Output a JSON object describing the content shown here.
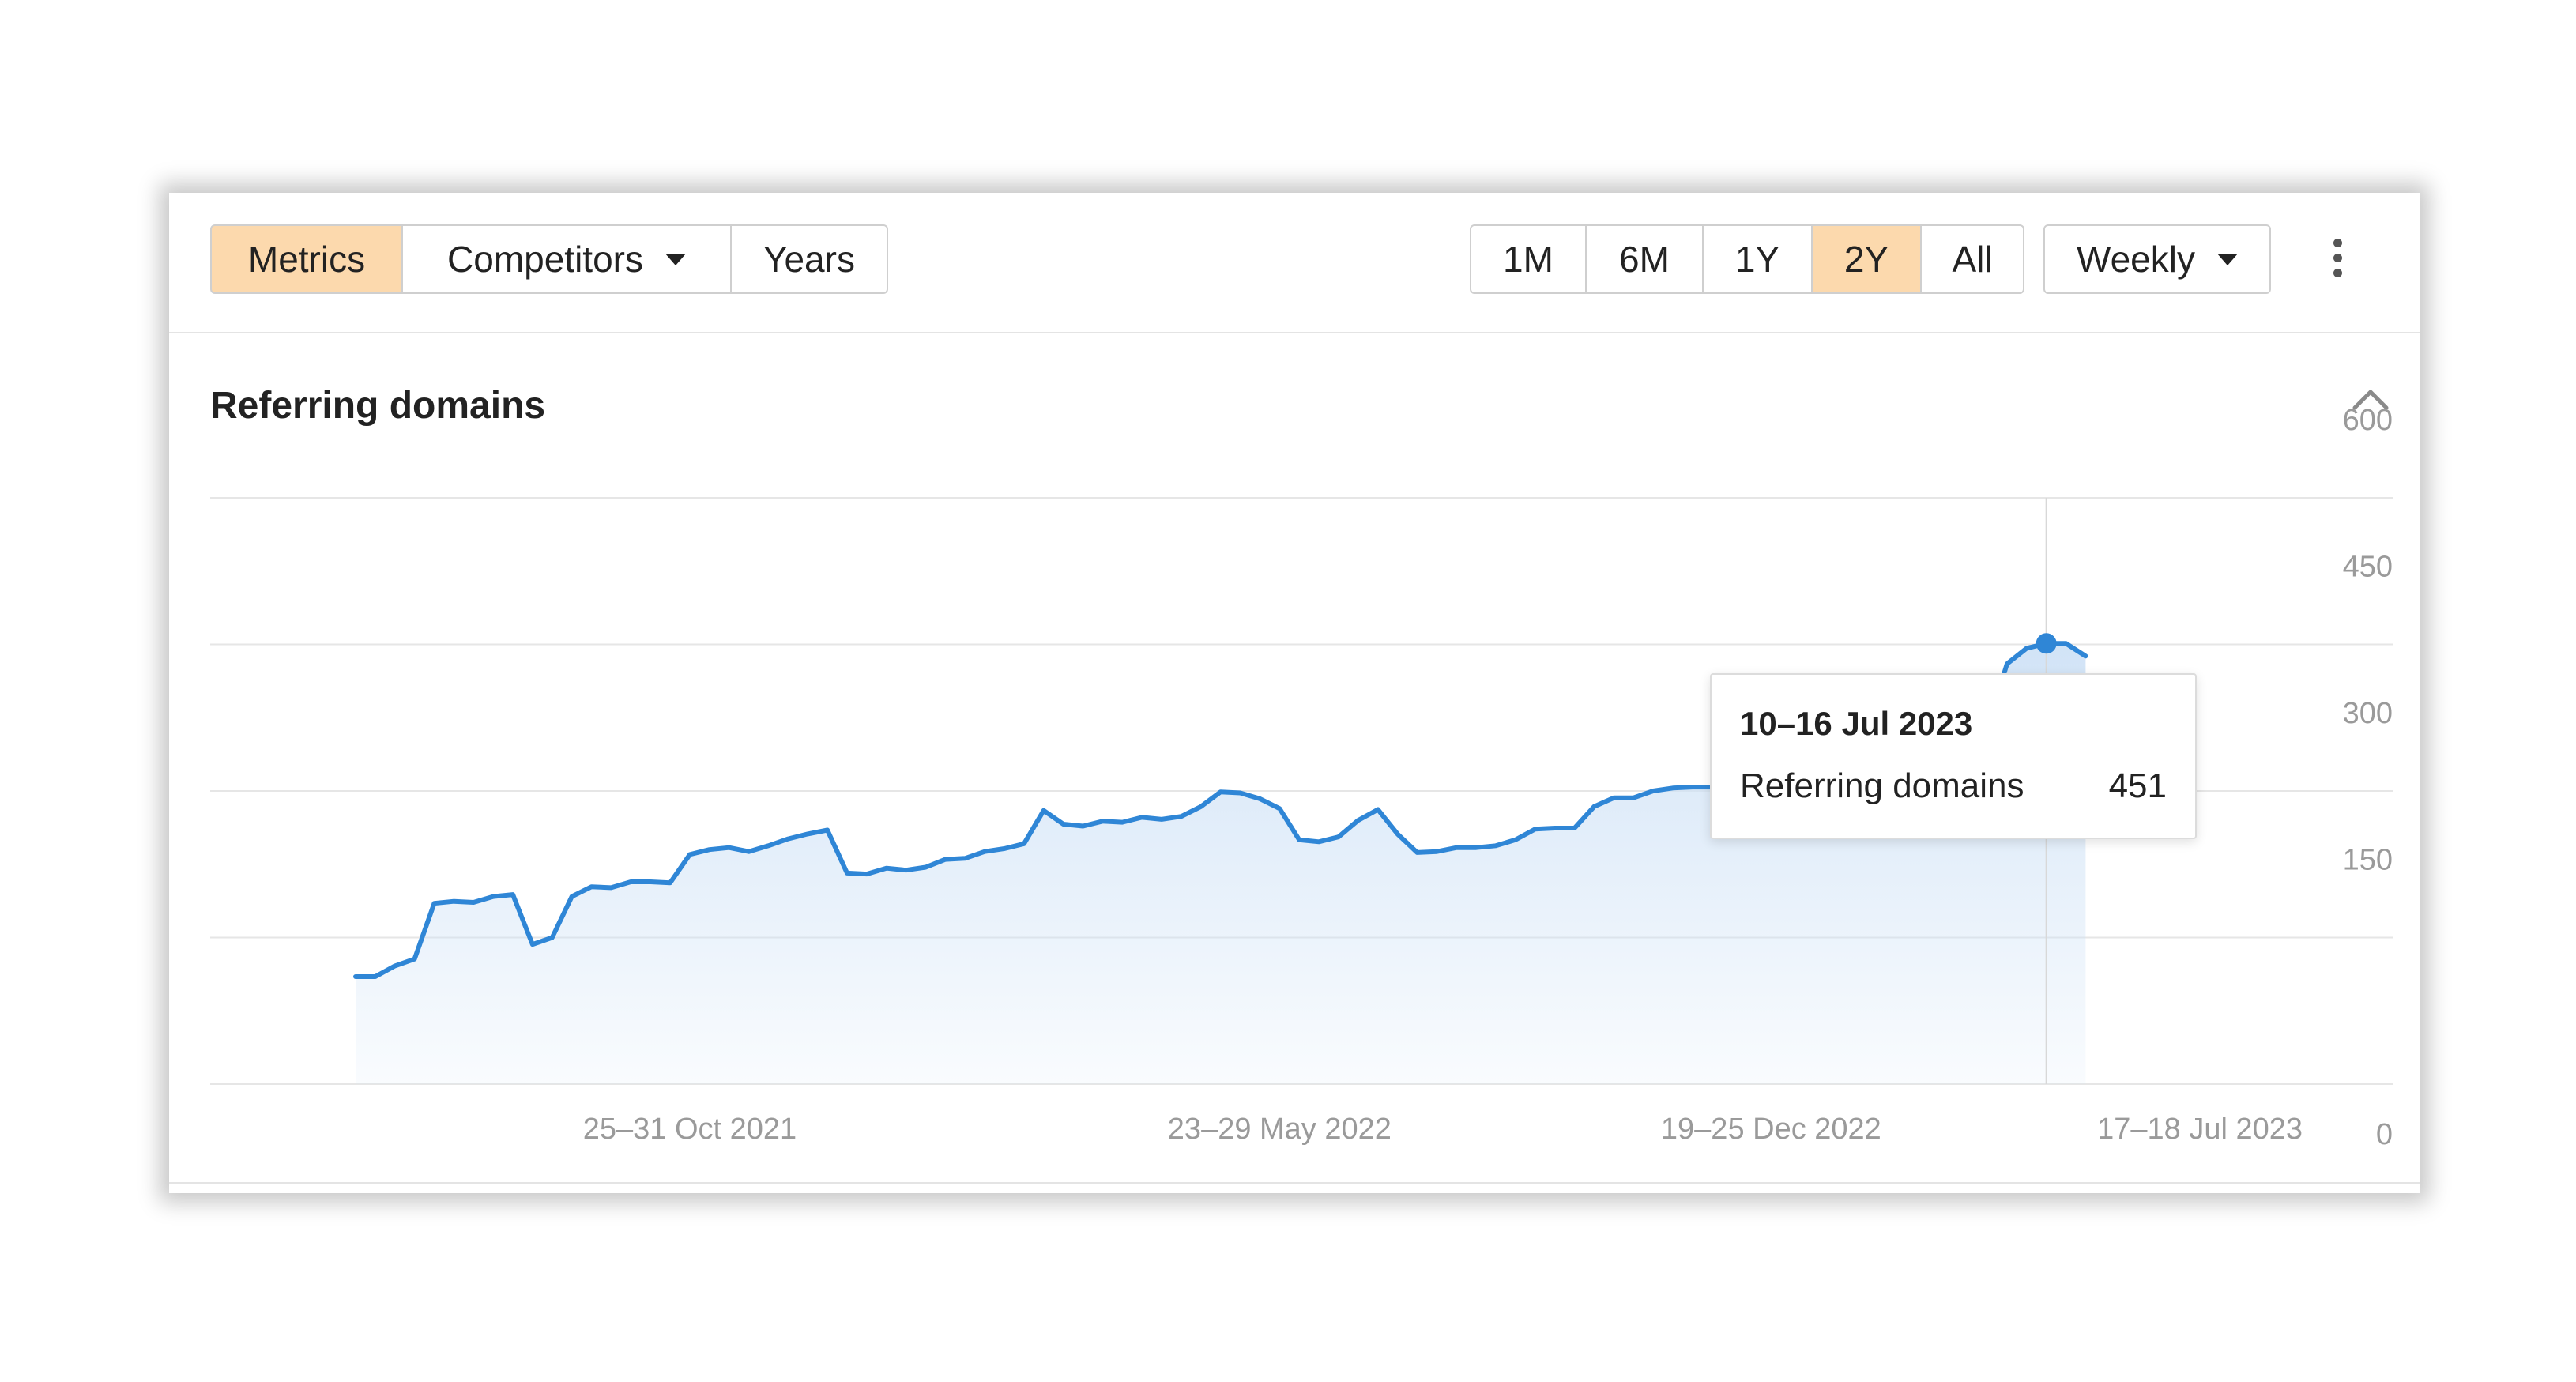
{
  "toolbar": {
    "view_tabs": [
      {
        "label": "Metrics",
        "active": true
      },
      {
        "label": "Competitors",
        "active": false,
        "dropdown": true
      },
      {
        "label": "Years",
        "active": false
      }
    ],
    "range_tabs": [
      {
        "label": "1M",
        "active": false
      },
      {
        "label": "6M",
        "active": false
      },
      {
        "label": "1Y",
        "active": false
      },
      {
        "label": "2Y",
        "active": true
      },
      {
        "label": "All",
        "active": false
      }
    ],
    "interval_label": "Weekly",
    "icons": {
      "interval": "chevron-down-icon",
      "more": "more-vertical-icon",
      "collapse": "chevron-up-icon"
    }
  },
  "section": {
    "title": "Referring domains"
  },
  "colors": {
    "active_tab": "#fcd9ad",
    "line": "#2f86d6",
    "area": "#cfe2f6",
    "grid": "#e6e6e6",
    "axis_text": "#9a9a9a"
  },
  "tooltip": {
    "date": "10–16 Jul 2023",
    "label": "Referring domains",
    "value": "451"
  },
  "chart_data": {
    "type": "area",
    "title": "Referring domains",
    "x_tick_labels": [
      "25–31 Oct 2021",
      "23–29 May 2022",
      "19–25 Dec 2022",
      "17–18 Jul 2023"
    ],
    "y_ticks": [
      0,
      150,
      300,
      450,
      600
    ],
    "ylim": [
      0,
      600
    ],
    "grid": true,
    "series": [
      {
        "name": "Referring domains",
        "values": [
          110,
          110,
          121,
          128,
          185,
          187,
          186,
          192,
          194,
          143,
          150,
          192,
          202,
          201,
          207,
          207,
          206,
          235,
          240,
          242,
          238,
          244,
          251,
          256,
          260,
          216,
          215,
          221,
          219,
          222,
          230,
          231,
          238,
          241,
          246,
          280,
          266,
          264,
          269,
          268,
          273,
          271,
          274,
          284,
          299,
          298,
          292,
          282,
          250,
          248,
          253,
          270,
          281,
          256,
          237,
          238,
          242,
          242,
          244,
          250,
          261,
          262,
          262,
          284,
          293,
          293,
          300,
          303,
          304,
          304,
          309,
          317,
          322,
          324,
          314,
          308,
          307,
          316,
          320,
          326,
          334,
          345,
          352,
          364,
          430,
          446,
          451,
          451,
          438
        ]
      }
    ],
    "highlight": {
      "index": 86,
      "date": "10–16 Jul 2023",
      "value": 451
    }
  }
}
